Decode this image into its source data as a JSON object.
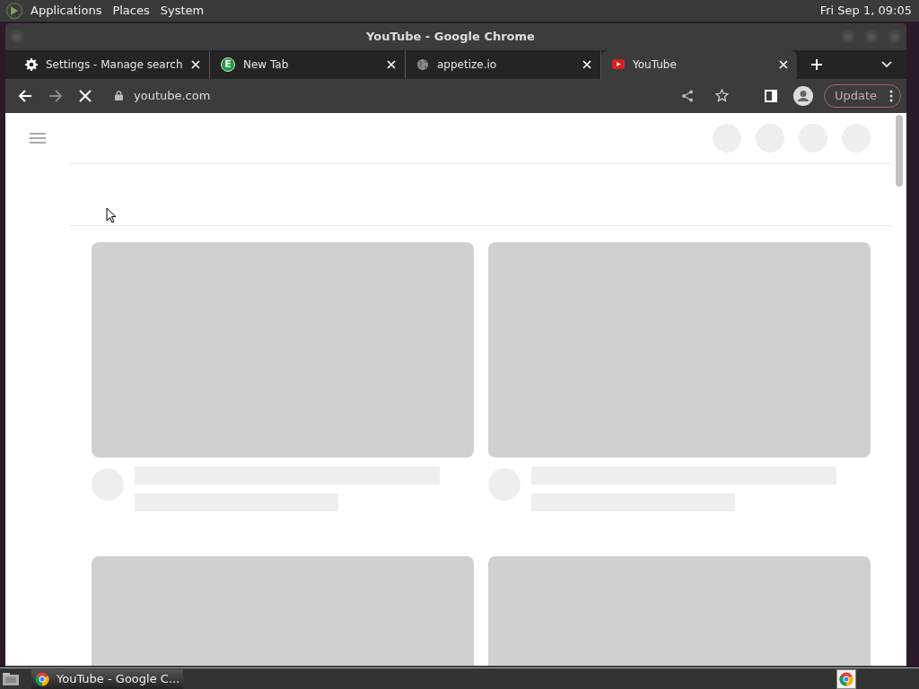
{
  "top_panel": {
    "menus": [
      "Applications",
      "Places",
      "System"
    ],
    "clock": "Fri Sep  1, 09:05"
  },
  "window": {
    "title": "YouTube - Google Chrome"
  },
  "tabs": [
    {
      "label": "Settings - Manage search",
      "kind": "gear",
      "selected": false
    },
    {
      "label": "New Tab",
      "kind": "letter",
      "icon_letter": "E",
      "selected": false
    },
    {
      "label": "appetize.io",
      "kind": "globe",
      "selected": false
    },
    {
      "label": "YouTube",
      "kind": "youtube",
      "selected": true
    }
  ],
  "toolbar": {
    "url": "youtube.com",
    "update_button": "Update"
  },
  "taskbar": {
    "items": [
      {
        "label": "YouTube - Google C...",
        "selected": true
      }
    ]
  }
}
